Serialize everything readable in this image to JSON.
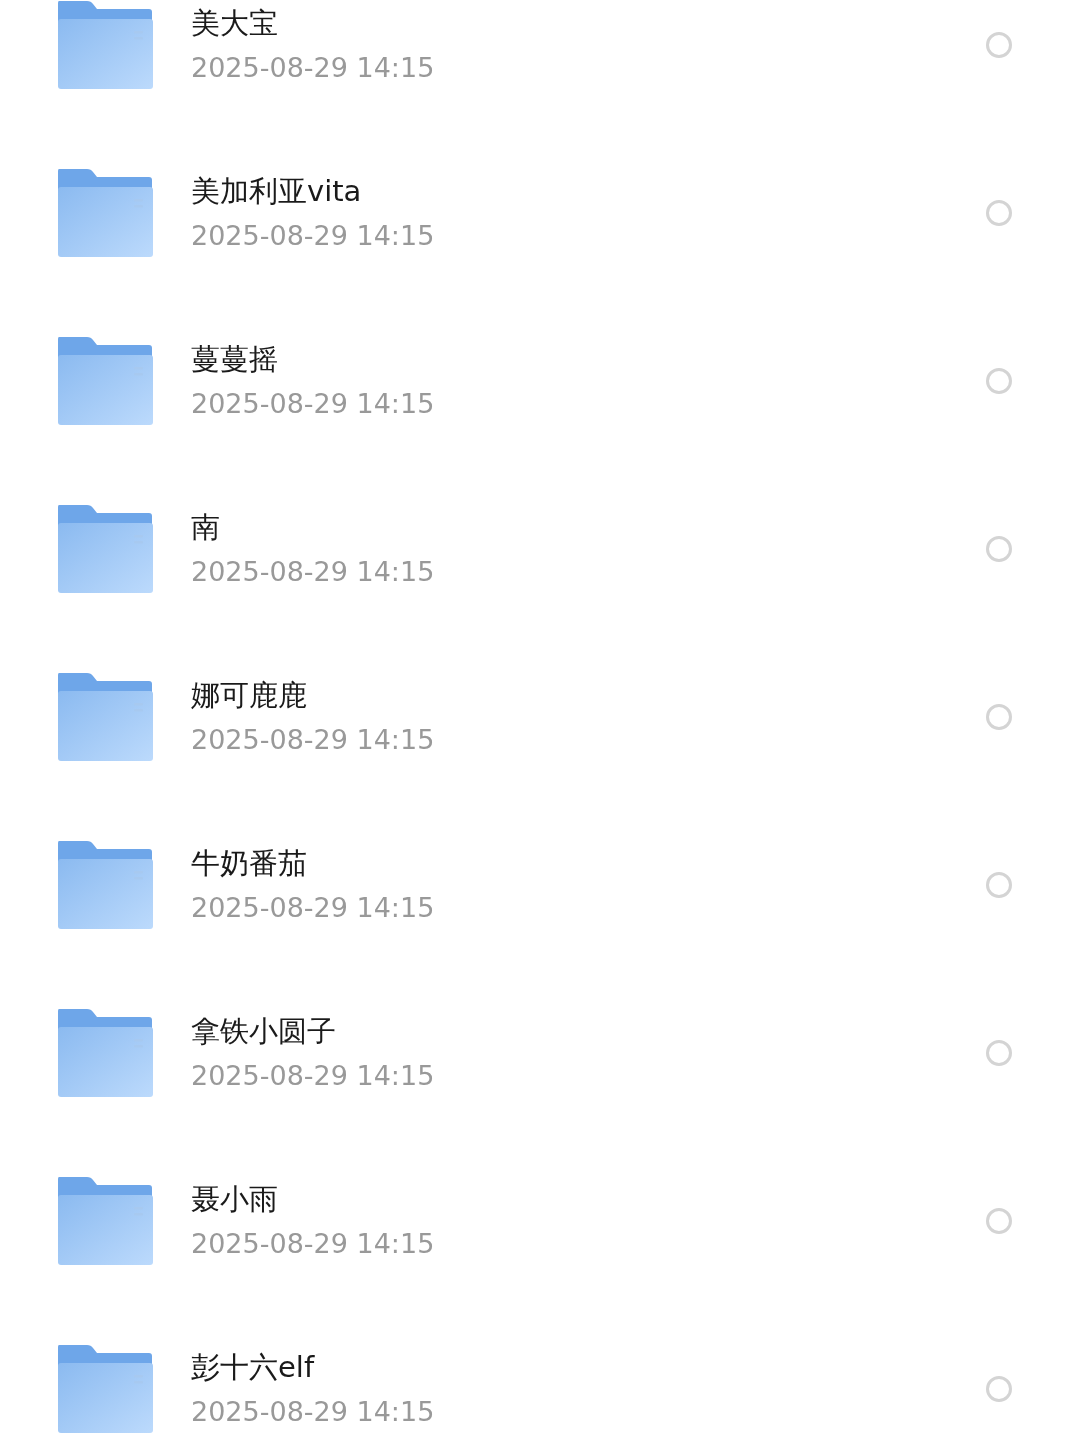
{
  "folders": [
    {
      "name": "美大宝",
      "date": "2025-08-29 14:15",
      "selected": false
    },
    {
      "name": "美加利亚vita",
      "date": "2025-08-29 14:15",
      "selected": false
    },
    {
      "name": "蔓蔓摇",
      "date": "2025-08-29 14:15",
      "selected": false
    },
    {
      "name": "南",
      "date": "2025-08-29 14:15",
      "selected": false
    },
    {
      "name": "娜可鹿鹿",
      "date": "2025-08-29 14:15",
      "selected": false
    },
    {
      "name": "牛奶番茄",
      "date": "2025-08-29 14:15",
      "selected": false
    },
    {
      "name": "拿铁小圆子",
      "date": "2025-08-29 14:15",
      "selected": false
    },
    {
      "name": "聂小雨",
      "date": "2025-08-29 14:15",
      "selected": false
    },
    {
      "name": "彭十六elf",
      "date": "2025-08-29 14:15",
      "selected": false
    }
  ]
}
